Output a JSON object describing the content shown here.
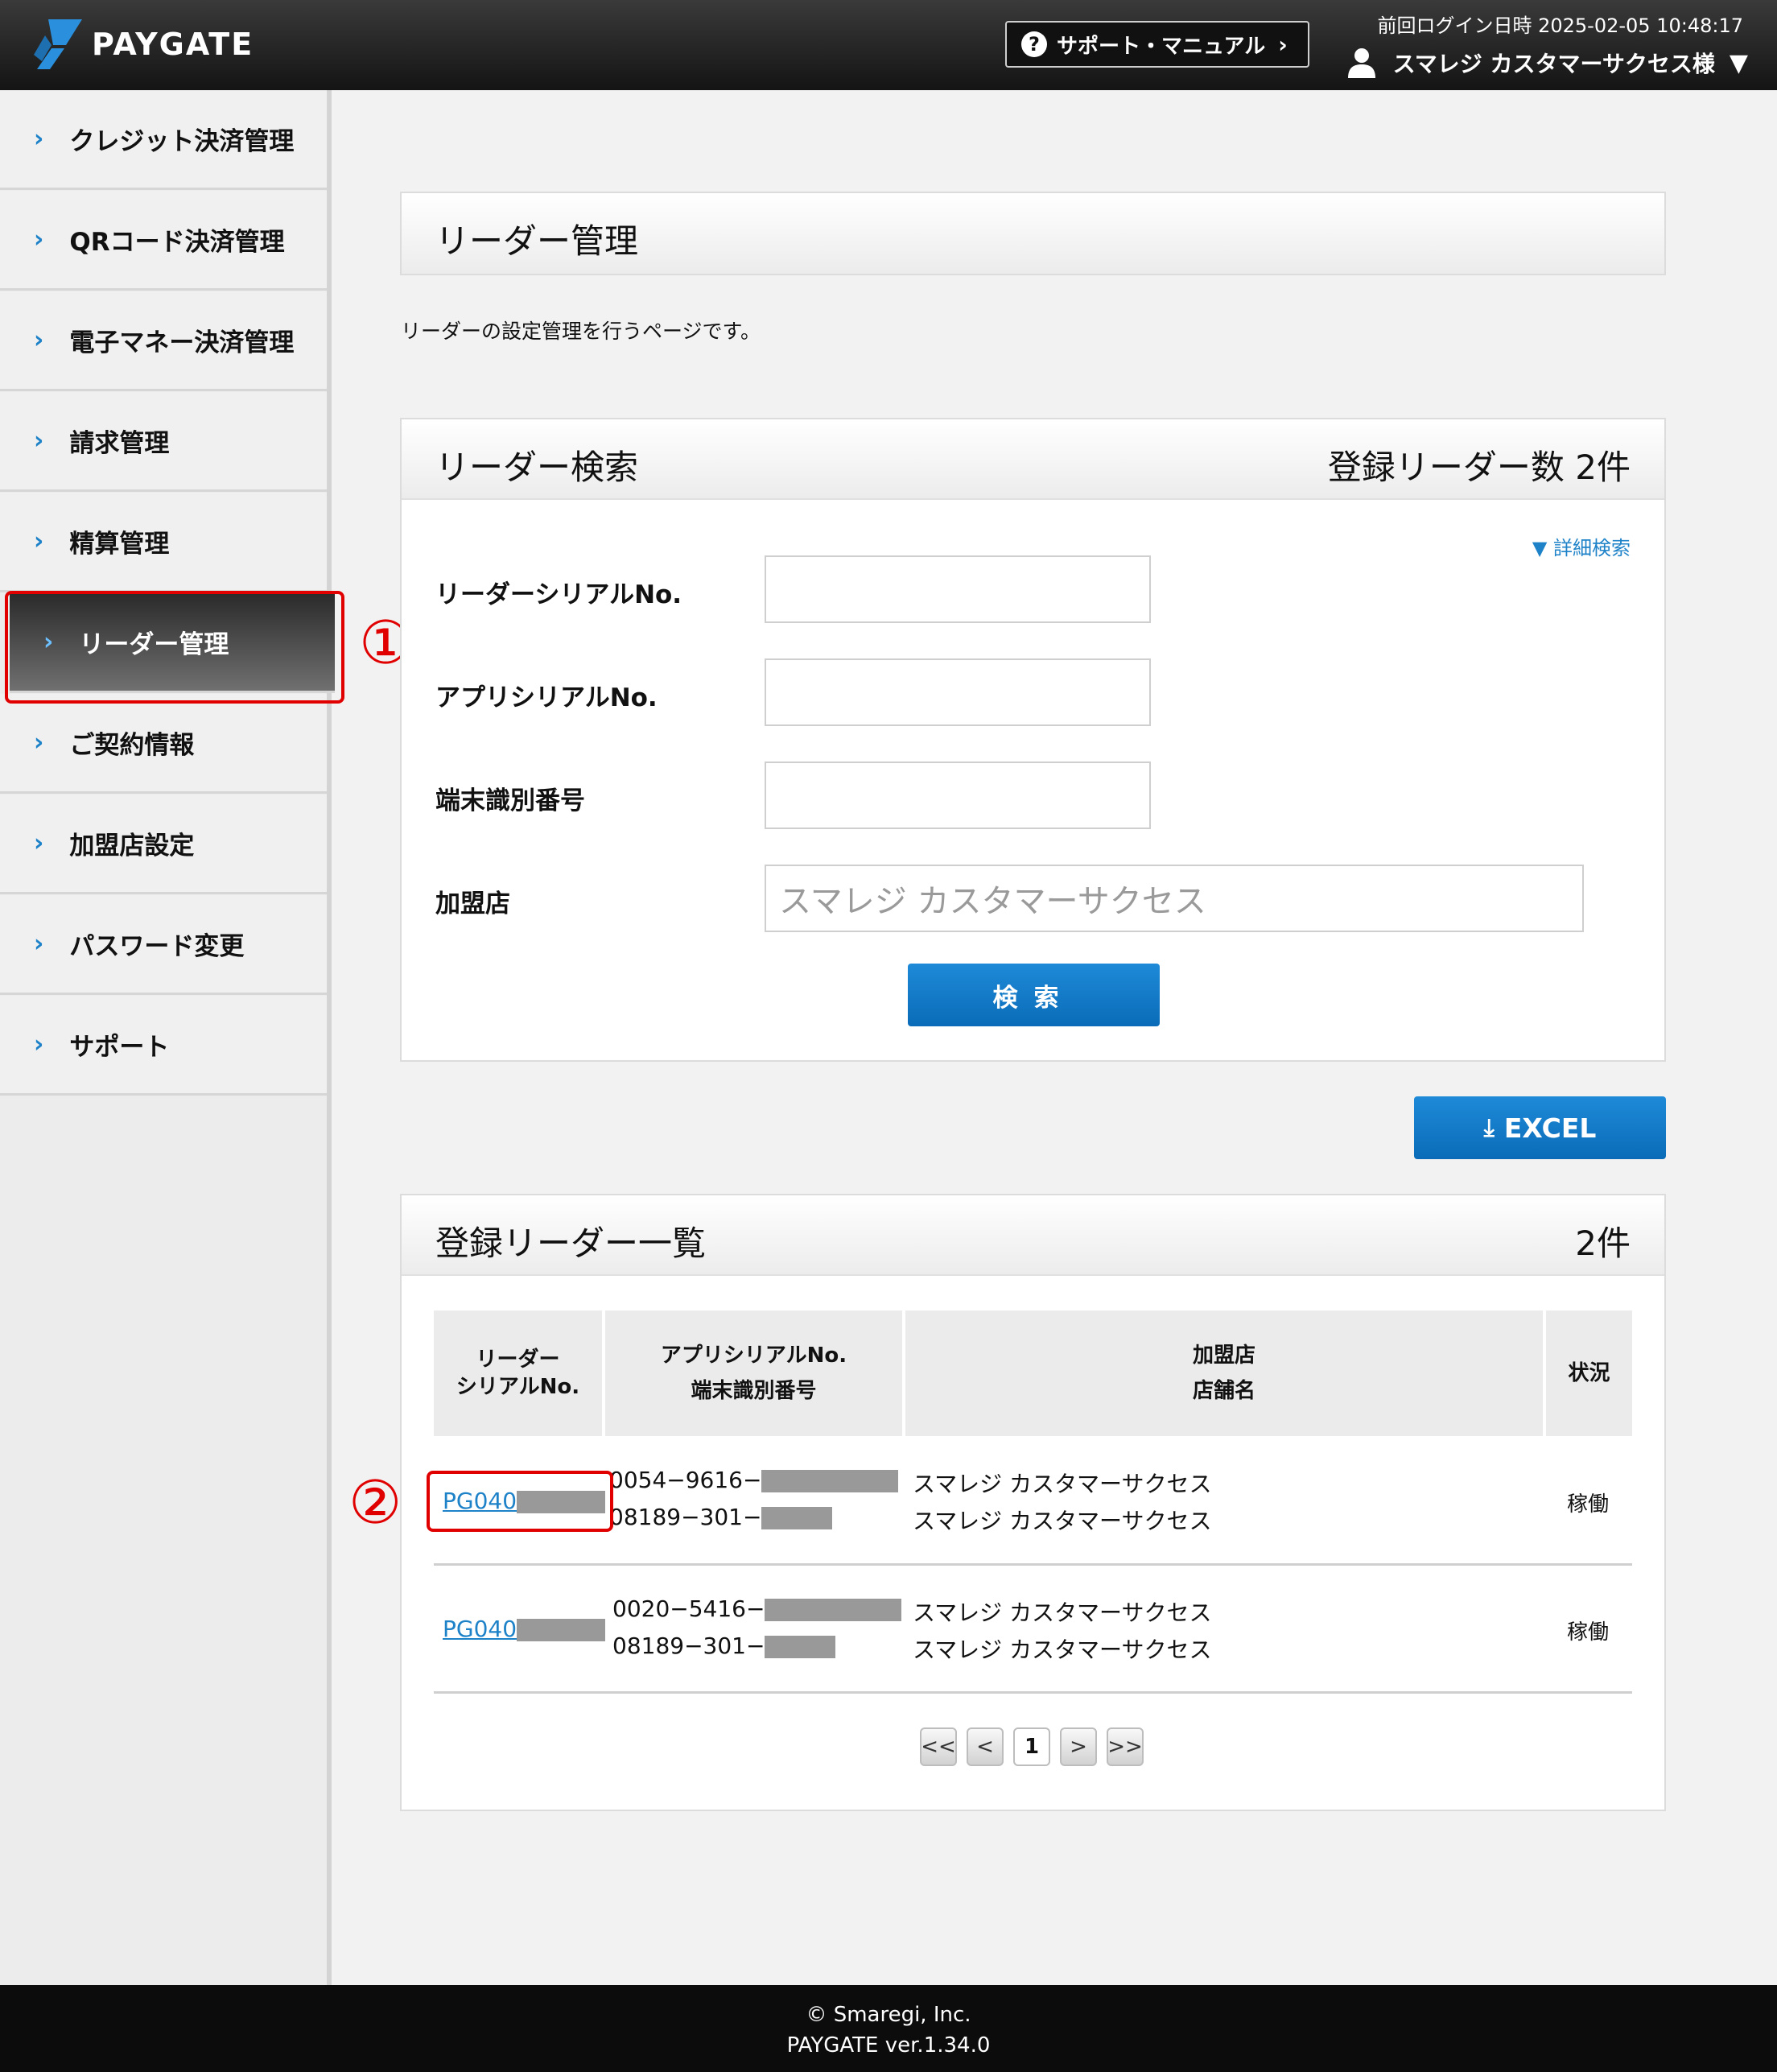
{
  "header": {
    "logo_text": "PAYGATE",
    "support_label": "サポート・マニュアル",
    "last_login": "前回ログイン日時 2025-02-05 10:48:17",
    "user_name": "スマレジ カスタマーサクセス様"
  },
  "sidebar": {
    "items": [
      {
        "label": "クレジット決済管理"
      },
      {
        "label": "QRコード決済管理"
      },
      {
        "label": "電子マネー決済管理"
      },
      {
        "label": "請求管理"
      },
      {
        "label": "精算管理"
      },
      {
        "label": "リーダー管理"
      },
      {
        "label": "ご契約情報"
      },
      {
        "label": "加盟店設定"
      },
      {
        "label": "パスワード変更"
      },
      {
        "label": "サポート"
      }
    ],
    "active_index": 5
  },
  "annotations": {
    "one": "①",
    "two": "②"
  },
  "page": {
    "title": "リーダー管理",
    "description": "リーダーの設定管理を行うページです。"
  },
  "search": {
    "title": "リーダー検索",
    "count": "登録リーダー数 2件",
    "detail_link": "▼ 詳細検索",
    "fields": [
      {
        "label": "リーダーシリアルNo.",
        "value": ""
      },
      {
        "label": "アプリシリアルNo.",
        "value": ""
      },
      {
        "label": "端末識別番号",
        "value": ""
      },
      {
        "label": "加盟店",
        "value": "スマレジ カスタマーサクセス"
      }
    ],
    "button": "検索"
  },
  "excel_label": "EXCEL",
  "list": {
    "title": "登録リーダー一覧",
    "count": "2件",
    "columns": [
      {
        "line1": "リーダー",
        "line2": "シリアルNo."
      },
      {
        "line1": "アプリシリアルNo.",
        "line2": "端末識別番号"
      },
      {
        "line1": "加盟店",
        "line2": "店舗名"
      },
      {
        "line1": "状況",
        "line2": ""
      }
    ],
    "rows": [
      {
        "serial": "PG040",
        "app_serial": "0054−9616−",
        "terminal_id": "08189−301−",
        "merchant": "スマレジ カスタマーサクセス",
        "store": "スマレジ カスタマーサクセス",
        "status": "稼働"
      },
      {
        "serial": "PG040",
        "app_serial": "0020−5416−",
        "terminal_id": "08189−301−",
        "merchant": "スマレジ カスタマーサクセス",
        "store": "スマレジ カスタマーサクセス",
        "status": "稼働"
      }
    ]
  },
  "pagination": {
    "first": "<<",
    "prev": "<",
    "current": "1",
    "next": ">",
    "last": ">>"
  },
  "footer": {
    "copyright": "© Smaregi, Inc.",
    "version": "PAYGATE ver.1.34.0"
  },
  "colors": {
    "accent": "#1e82c8",
    "highlight": "#e00000",
    "header_bg": "#141414"
  }
}
